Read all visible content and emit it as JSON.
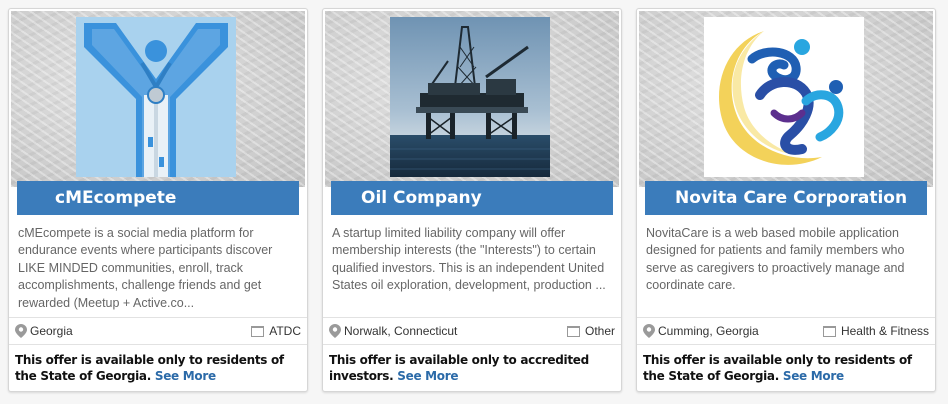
{
  "cards": [
    {
      "title": "cMEcompete",
      "description": "cMEcompete is a social media platform for endurance events where participants discover LIKE MINDED communities, enroll, track accomplishments, challenge friends and get rewarded (Meetup + Active.co...",
      "location": "Georgia",
      "category": "ATDC",
      "offer": "This offer is available only to residents of the State of Georgia.",
      "see_more": "See More",
      "logo_icon": "person-with-medal-logo"
    },
    {
      "title": "Oil Company",
      "description": "A startup limited liability company will offer membership interests (the \"Interests\") to certain qualified investors. This is an independent United States oil exploration, development, production ...",
      "location": "Norwalk, Connecticut",
      "category": "Other",
      "offer": "This offer is available only to accredited investors.",
      "see_more": "See More",
      "logo_icon": "oil-platform-photo"
    },
    {
      "title": "Novita Care Corporation",
      "description": "NovitaCare is a web based mobile application designed for patients and family members who serve as caregivers to proactively manage and coordinate care.",
      "location": "Cumming, Georgia",
      "category": "Health & Fitness",
      "offer": "This offer is available only to residents of the State of Georgia.",
      "see_more": "See More",
      "logo_icon": "novita-care-logo"
    }
  ],
  "colors": {
    "title_bar": "#3b7cbb",
    "link": "#2b6aa8",
    "description_text": "#666666"
  }
}
